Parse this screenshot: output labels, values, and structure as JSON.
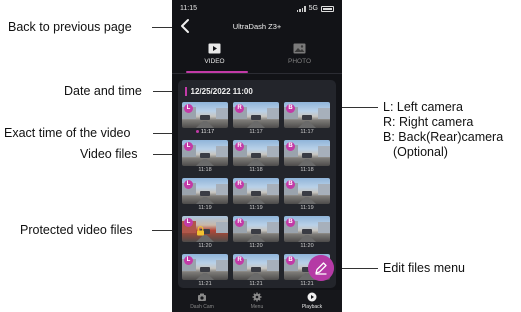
{
  "annotations": {
    "back": "Back to previous page",
    "date_time": "Date and time",
    "exact_time": "Exact time of the video",
    "video_files": "Video files",
    "protected": "Protected video files",
    "edit_menu": "Edit files menu",
    "camera_notes": [
      "L: Left camera",
      "R: Right camera",
      "B: Back(Rear)camera",
      "(Optional)"
    ]
  },
  "status": {
    "time": "11:15",
    "network": "5G"
  },
  "header": {
    "title": "UltraDash Z3+"
  },
  "tabs": [
    {
      "label": "VIDEO",
      "icon": "video-icon",
      "active": true
    },
    {
      "label": "PHOTO",
      "icon": "photo-icon",
      "active": false
    }
  ],
  "date_group": "12/25/2022 11:00",
  "videos": [
    {
      "cam": "L",
      "time": "11:17",
      "exact": true,
      "protected": false,
      "style": "street"
    },
    {
      "cam": "R",
      "time": "11:17",
      "exact": false,
      "protected": false,
      "style": "street"
    },
    {
      "cam": "B",
      "time": "11:17",
      "exact": false,
      "protected": false,
      "style": "street"
    },
    {
      "cam": "L",
      "time": "11:18",
      "exact": false,
      "protected": false,
      "style": "street"
    },
    {
      "cam": "R",
      "time": "11:18",
      "exact": false,
      "protected": false,
      "style": "street"
    },
    {
      "cam": "B",
      "time": "11:18",
      "exact": false,
      "protected": false,
      "style": "street"
    },
    {
      "cam": "L",
      "time": "11:19",
      "exact": false,
      "protected": false,
      "style": "street"
    },
    {
      "cam": "R",
      "time": "11:19",
      "exact": false,
      "protected": false,
      "style": "street"
    },
    {
      "cam": "B",
      "time": "11:19",
      "exact": false,
      "protected": false,
      "style": "street"
    },
    {
      "cam": "L",
      "time": "11:20",
      "exact": false,
      "protected": true,
      "style": "red"
    },
    {
      "cam": "R",
      "time": "11:20",
      "exact": false,
      "protected": false,
      "style": "street"
    },
    {
      "cam": "B",
      "time": "11:20",
      "exact": false,
      "protected": false,
      "style": "street"
    },
    {
      "cam": "L",
      "time": "11:21",
      "exact": false,
      "protected": false,
      "style": "street"
    },
    {
      "cam": "R",
      "time": "11:21",
      "exact": false,
      "protected": false,
      "style": "street"
    },
    {
      "cam": "B",
      "time": "11:21",
      "exact": false,
      "protected": false,
      "style": "street"
    }
  ],
  "bottom_nav": [
    {
      "label": "Dash Cam",
      "icon": "camera-icon",
      "active": false
    },
    {
      "label": "Menu",
      "icon": "gear-icon",
      "active": false
    },
    {
      "label": "Playback",
      "icon": "play-icon",
      "active": true
    }
  ],
  "colors": {
    "accent": "#c23aa7",
    "background": "#121317",
    "panel": "#23252b"
  }
}
